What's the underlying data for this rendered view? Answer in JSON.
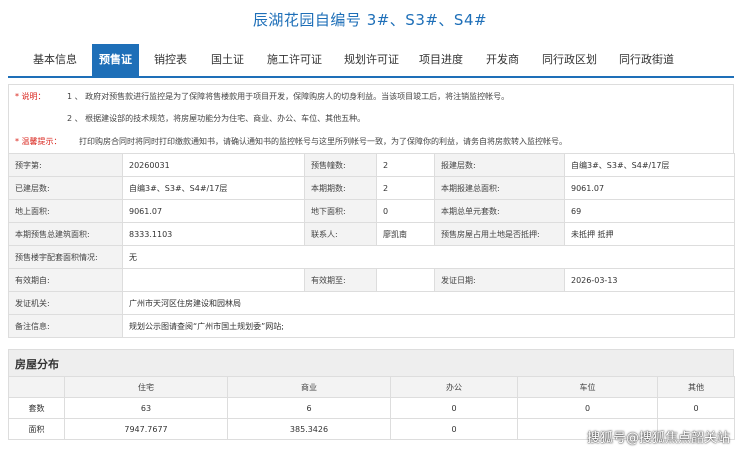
{
  "page_title": "辰湖花园自编号 3#、S3#、S4#",
  "tabs": [
    "基本信息",
    "预售证",
    "销控表",
    "国土证",
    "施工许可证",
    "规划许可证",
    "项目进度",
    "开发商",
    "同行政区划",
    "同行政街道"
  ],
  "active_tab": "预售证",
  "notice": {
    "explain_label": "* 说明：",
    "explain_1": "1 、 政府对预售款进行监控是为了保障将售楼款用于项目开发，保障购房人的切身利益。当该项目竣工后，将注销监控帐号。",
    "explain_2": "2 、 根据建设部的技术规范，将房屋功能分为住宅、商业、办公、车位、其他五种。",
    "warn_label": "* 温馨提示：",
    "warn_text": "打印购房合同时将同时打印缴款通知书，请确认通知书的监控帐号与这里所列帐号一致，为了保障你的利益，请务自将房款转入监控帐号。"
  },
  "info": {
    "presale_no_label": "预字第:",
    "presale_no": "20260031",
    "presale_buildings_label": "预售幢数:",
    "presale_buildings": "2",
    "report_floors_label": "报建层数:",
    "report_floors": "自编3#、S3#、S4#/17层",
    "built_floors_label": "已建层数:",
    "built_floors": "自编3#、S3#、S4#/17层",
    "phase_label": "本期期数:",
    "phase": "2",
    "report_total_area_label": "本期报建总面积:",
    "report_total_area": "9061.07",
    "above_area_label": "地上面积:",
    "above_area": "9061.07",
    "under_area_label": "地下面积:",
    "under_area": "0",
    "total_units_label": "本期总单元套数:",
    "total_units": "69",
    "presale_area_label": "本期预售总建筑面积:",
    "presale_area": "8333.1103",
    "contact_label": "联系人:",
    "contact": "廖凯南",
    "mortgage_label": "预售房屋占用土地是否抵押:",
    "mortgage": "未抵押 抵押",
    "supporting_label": "预售楼宇配套面积情况:",
    "supporting": "无",
    "valid_from_label": "有效期自:",
    "valid_from": "",
    "valid_to_label": "有效期至:",
    "valid_to": "",
    "issue_date_label": "发证日期:",
    "issue_date": "2026-03-13",
    "issuer_label": "发证机关:",
    "issuer": "广州市天河区住房建设和园林局",
    "remark_label": "备注信息:",
    "remark": "规划公示图请查阅“广州市国土规划委”网站;"
  },
  "distribution": {
    "section_title": "房屋分布",
    "columns": [
      "住宅",
      "商业",
      "办公",
      "车位",
      "其他"
    ],
    "rows": [
      {
        "label": "套数",
        "values": [
          "63",
          "6",
          "0",
          "0",
          "0"
        ]
      },
      {
        "label": "面积",
        "values": [
          "7947.7677",
          "385.3426",
          "0",
          "",
          ""
        ]
      }
    ]
  },
  "watermark": "搜狐号@搜狐焦点韶关站"
}
